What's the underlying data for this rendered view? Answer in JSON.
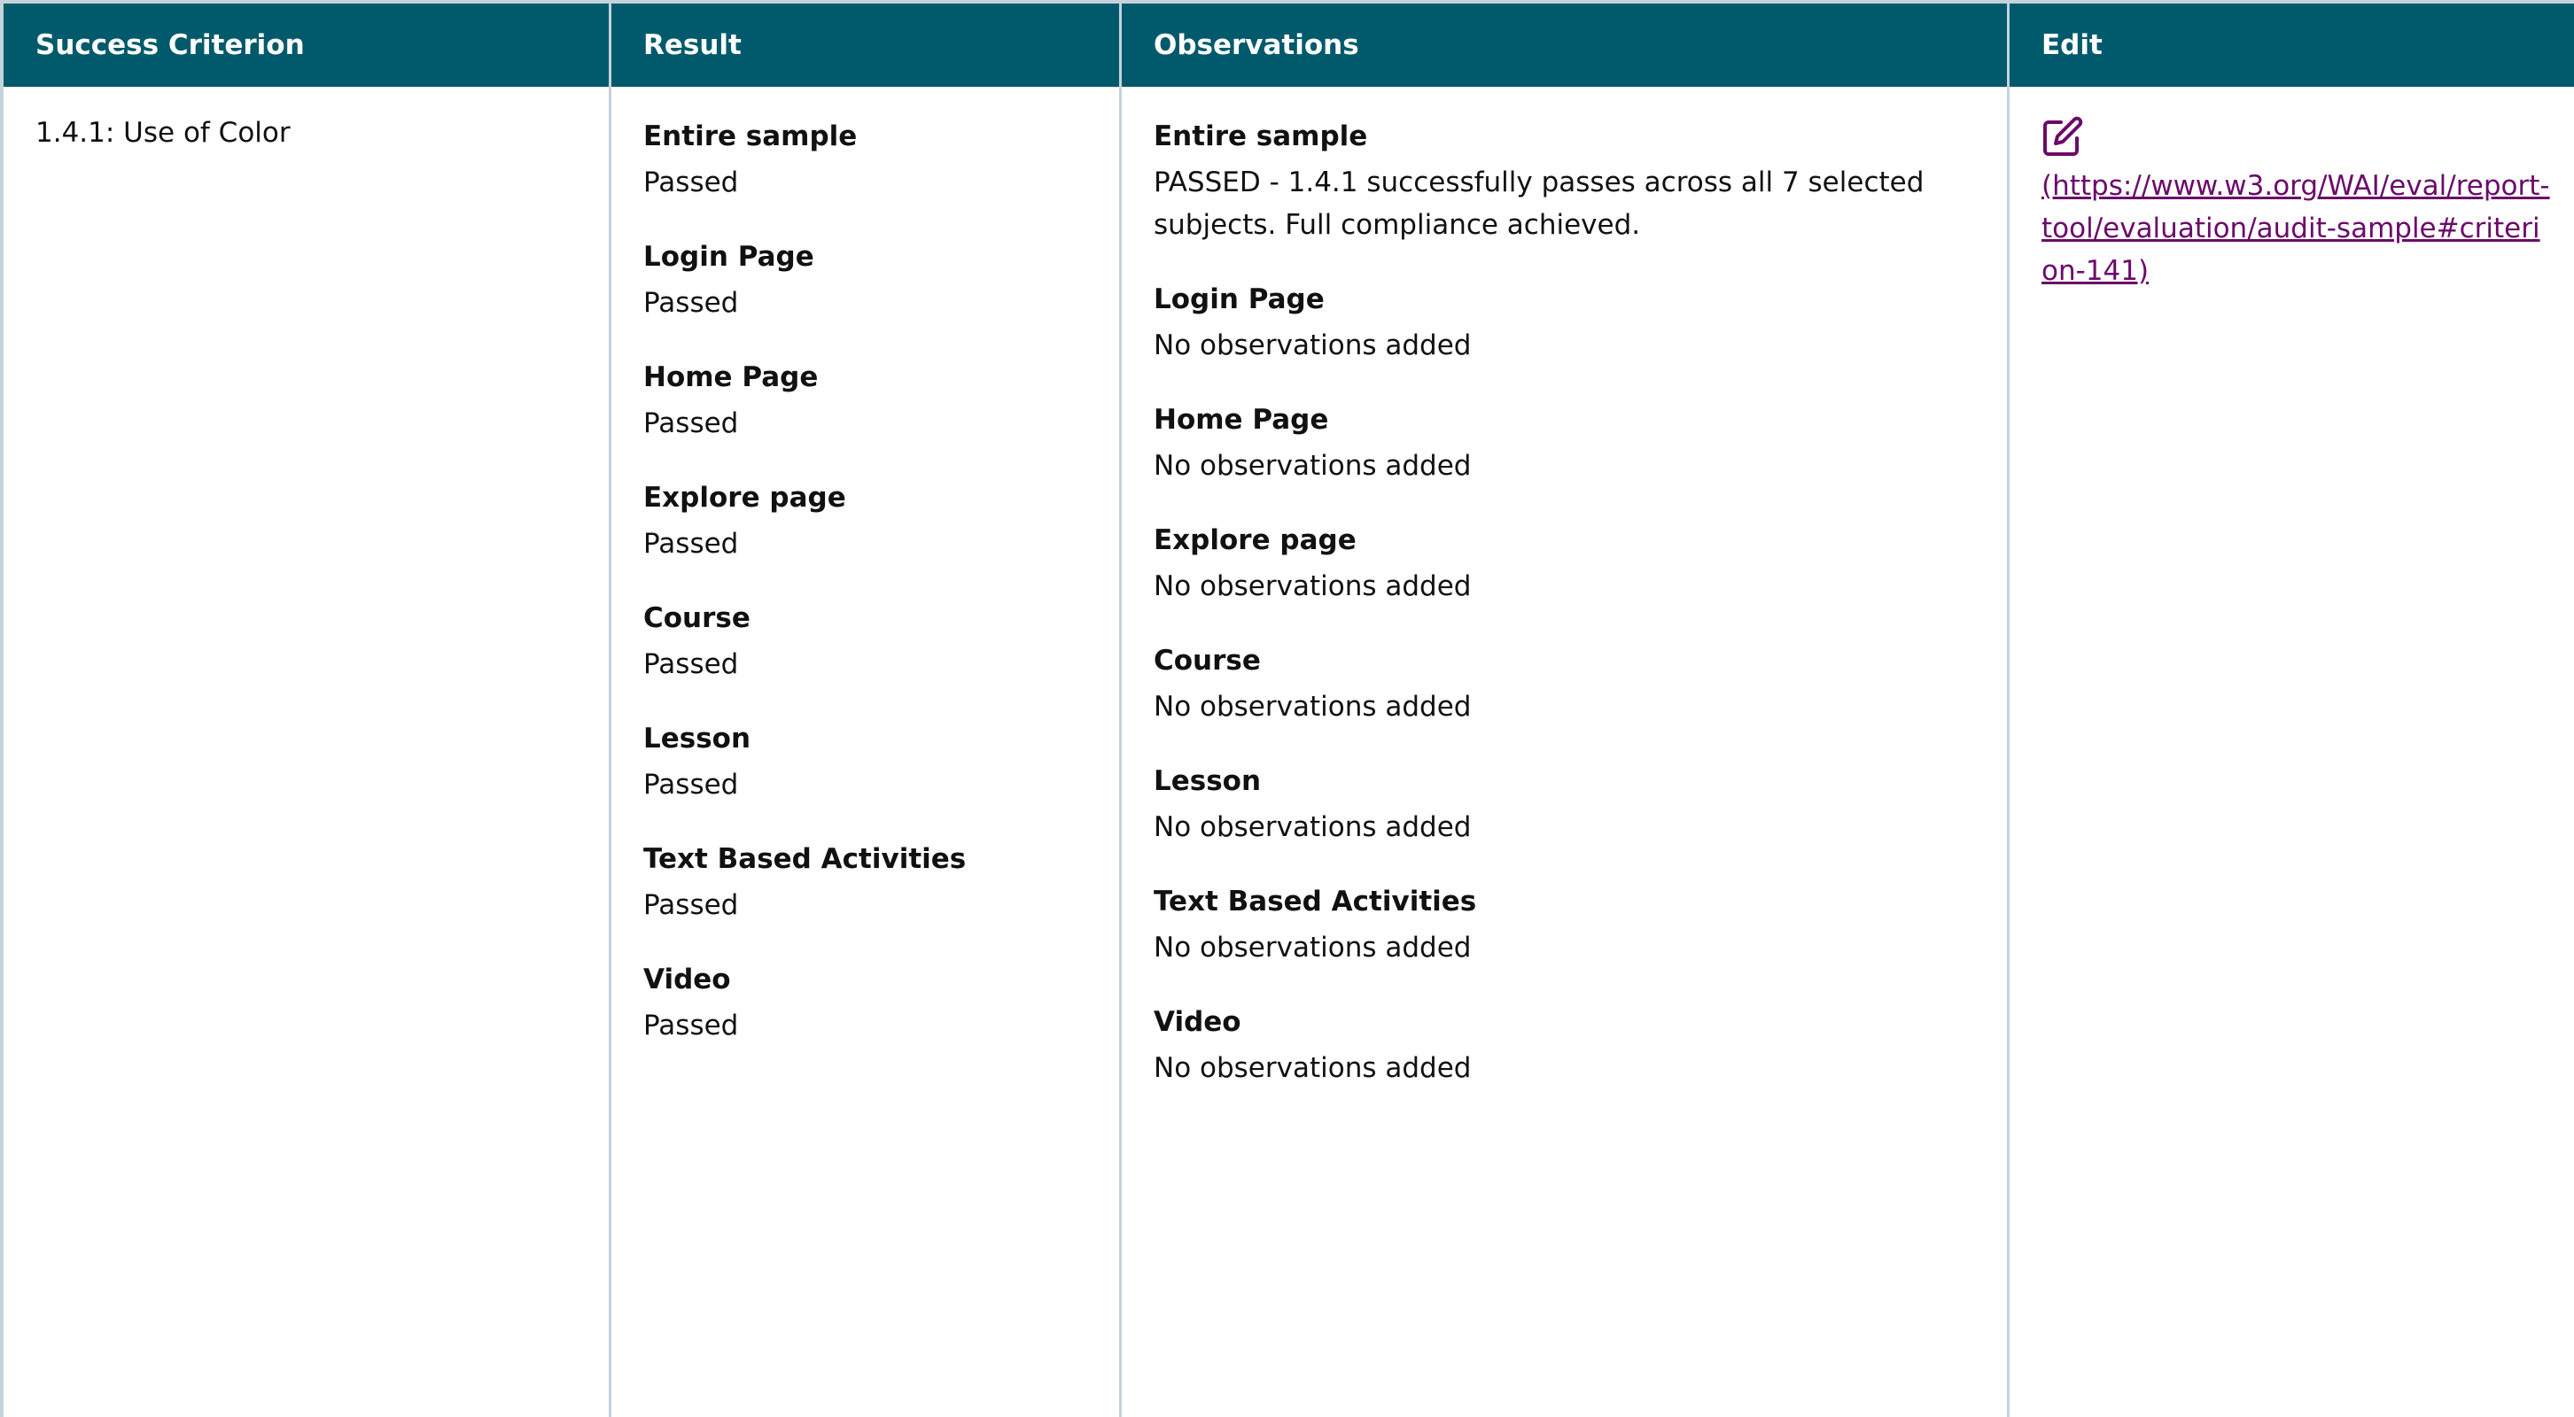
{
  "table": {
    "headers": {
      "criterion": "Success Criterion",
      "result": "Result",
      "observations": "Observations",
      "edit": "Edit"
    },
    "row": {
      "criterion": "1.4.1: Use of Color",
      "results": [
        {
          "label": "Entire sample",
          "value": "Passed"
        },
        {
          "label": "Login Page",
          "value": "Passed"
        },
        {
          "label": "Home Page",
          "value": "Passed"
        },
        {
          "label": "Explore page",
          "value": "Passed"
        },
        {
          "label": "Course",
          "value": "Passed"
        },
        {
          "label": "Lesson",
          "value": "Passed"
        },
        {
          "label": "Text Based Activities",
          "value": "Passed"
        },
        {
          "label": "Video",
          "value": "Passed"
        }
      ],
      "observations": [
        {
          "label": "Entire sample",
          "value": "PASSED - 1.4.1 successfully passes across all 7 selected subjects. Full compliance achieved."
        },
        {
          "label": "Login Page",
          "value": "No observations added"
        },
        {
          "label": "Home Page",
          "value": "No observations added"
        },
        {
          "label": "Explore page",
          "value": "No observations added"
        },
        {
          "label": "Course",
          "value": "No observations added"
        },
        {
          "label": "Lesson",
          "value": "No observations added"
        },
        {
          "label": "Text Based Activities",
          "value": "No observations added"
        },
        {
          "label": "Video",
          "value": "No observations added"
        }
      ],
      "edit": {
        "icon": "edit-icon",
        "link_text": "(https://www.w3.org/WAI/eval/report-tool/evaluation/audit-sample#criterion-141)"
      }
    }
  },
  "colors": {
    "header_bg": "#005a6b",
    "link": "#6b0a6b",
    "border": "#c5d3dc"
  }
}
